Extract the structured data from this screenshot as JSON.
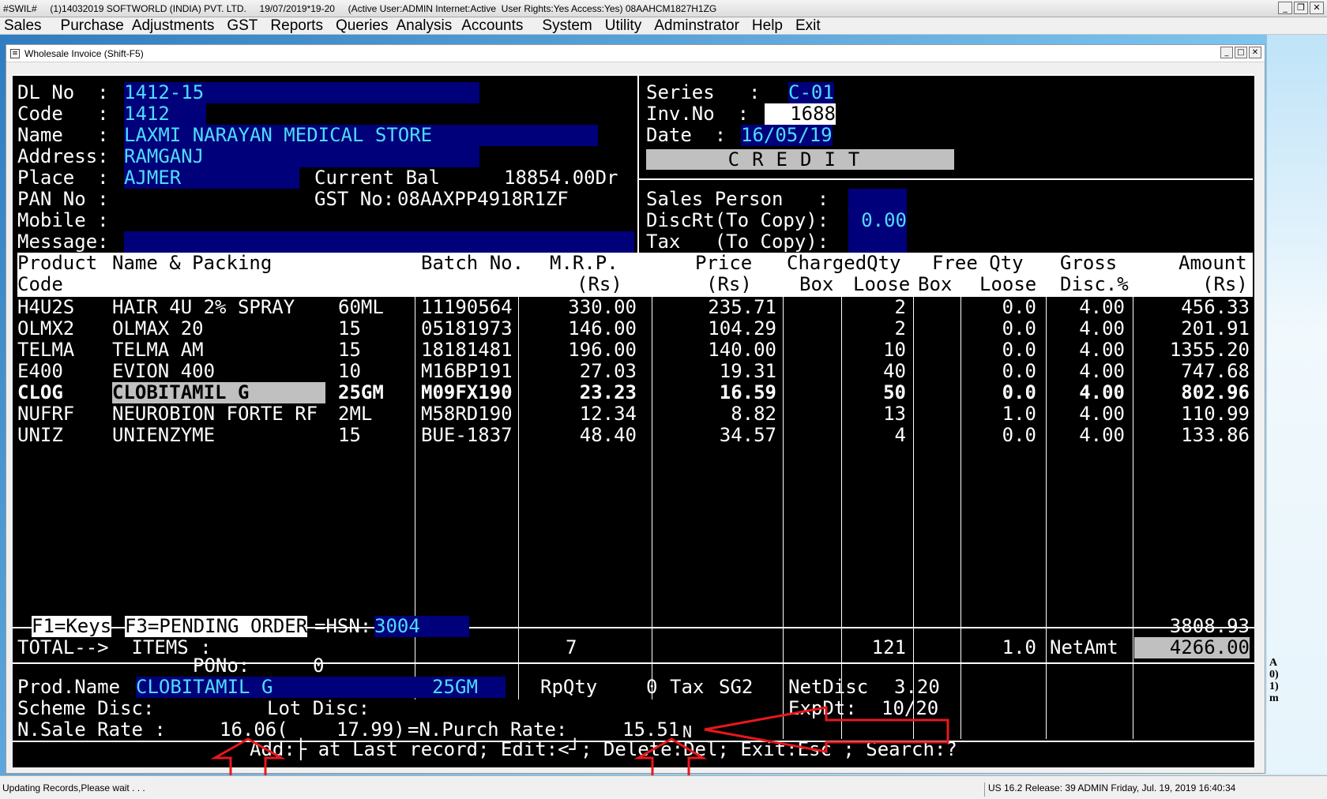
{
  "app_title": "#SWIL#     (1)14032019 SOFTWORLD (INDIA) PVT. LTD.     19/07/2019*19-20     (Active User:ADMIN Internet:Active  User Rights:Yes Access:Yes) 08AAHCM1827H1ZG",
  "menu": [
    "Sales",
    "Purchase",
    "Adjustments",
    "GST",
    "Reports",
    "Queries",
    "Analysis",
    "Accounts",
    "System",
    "Utility",
    "Adminstrator",
    "Help",
    "Exit"
  ],
  "inner_window_title": "Wholesale Invoice (Shift-F5)",
  "party": {
    "dl_no_label": "DL No  :",
    "dl_no": "1412-15",
    "code_label": "Code   :",
    "code": "1412",
    "name_label": "Name   :",
    "name": "LAXMI NARAYAN MEDICAL STORE",
    "address_label": "Address:",
    "address": "RAMGANJ",
    "place_label": "Place  :",
    "place": "AJMER",
    "current_bal_label": "Current Bal",
    "current_bal": "18854.00Dr",
    "pan_label": "PAN No :",
    "gst_label": "GST No:",
    "gst": "08AAXPP4918R1ZF",
    "mobile_label": "Mobile :",
    "message_label": "Message:"
  },
  "invoice": {
    "series_label": "Series   :",
    "series": "C-01",
    "inv_label": "Inv.No  :",
    "inv_no": "1688",
    "date_label": "Date  :",
    "date": "16/05/19",
    "mode": "CREDIT",
    "sales_person_label": "Sales Person   :",
    "discrt_label": "DiscRt(To Copy):",
    "discrt": "0.00",
    "tax_label": "Tax   (To Copy):"
  },
  "columns": {
    "product": "Product",
    "code": "Code",
    "name_packing": "Name & Packing",
    "batch": "Batch No.",
    "mrp": "M.R.P.",
    "mrp_unit": "(Rs)",
    "price": "Price",
    "price_unit": "(Rs)",
    "charged_qty": "ChargedQty",
    "box": "Box",
    "loose": "Loose",
    "free_qty": "Free Qty",
    "free_box": "Box",
    "free_loose": "Loose",
    "gross": "Gross",
    "disc": "Disc.%",
    "amount": "Amount",
    "amount_unit": "(Rs)"
  },
  "rows": [
    {
      "code": "H4U2S",
      "name": "HAIR 4U 2% SPRAY",
      "pack": "60ML",
      "batch": "11190564",
      "mrp": "330.00",
      "price": "235.71",
      "loose": "2",
      "free": "0.0",
      "disc": "4.00",
      "amount": "456.33"
    },
    {
      "code": "OLMX2",
      "name": "OLMAX 20",
      "pack": "15",
      "batch": "05181973",
      "mrp": "146.00",
      "price": "104.29",
      "loose": "2",
      "free": "0.0",
      "disc": "4.00",
      "amount": "201.91"
    },
    {
      "code": "TELMA",
      "name": "TELMA AM",
      "pack": "15",
      "batch": "18181481",
      "mrp": "196.00",
      "price": "140.00",
      "loose": "10",
      "free": "0.0",
      "disc": "4.00",
      "amount": "1355.20"
    },
    {
      "code": "E400",
      "name": "EVION 400",
      "pack": "10",
      "batch": "M16BP191",
      "mrp": "27.03",
      "price": "19.31",
      "loose": "40",
      "free": "0.0",
      "disc": "4.00",
      "amount": "747.68"
    },
    {
      "code": "CLOG",
      "name": "CLOBITAMIL G",
      "pack": "25GM",
      "batch": "M09FX190",
      "mrp": "23.23",
      "price": "16.59",
      "loose": "50",
      "free": "0.0",
      "disc": "4.00",
      "amount": "802.96"
    },
    {
      "code": "NUFRF",
      "name": "NEUROBION FORTE RF",
      "pack": "2ML",
      "batch": "M58RD190",
      "mrp": "12.34",
      "price": "8.82",
      "loose": "13",
      "free": "1.0",
      "disc": "4.00",
      "amount": "110.99"
    },
    {
      "code": "UNIZ",
      "name": "UNIENZYME",
      "pack": "15",
      "batch": "BUE-1837",
      "mrp": "48.40",
      "price": "34.57",
      "loose": "4",
      "free": "0.0",
      "disc": "4.00",
      "amount": "133.86"
    }
  ],
  "footer": {
    "f1": "F1=Keys",
    "f3": "F3=PENDING ORDER",
    "hsn_label": "=HSN:",
    "hsn": "3004",
    "gross_total": "3808.93",
    "total_label": "TOTAL-->  ITEMS :",
    "items": "7",
    "total_qty": "121",
    "total_free": "1.0",
    "netamt_label": "NetAmt",
    "netamt": "4266.00",
    "pono_label": "PONo:",
    "pono": "0"
  },
  "detail": {
    "prod_name_label": "Prod.Name",
    "prod_name": "CLOBITAMIL G",
    "prod_pack": "25GM",
    "rpqty_label": "RpQty",
    "rpqty": "0",
    "tax_label": "Tax",
    "tax": "SG2",
    "netdisc_label": "NetDisc",
    "netdisc": "3.20",
    "scheme_label": "Scheme Disc:",
    "lot_label": "Lot Disc:",
    "expdt_label": "ExpDt:",
    "expdt": "10/20",
    "sale_rate_label": "N.Sale Rate :",
    "sale_rate": "16.06(",
    "sale_rate_2": "17.99)",
    "purch_rate_label": "=N.Purch Rate:",
    "purch_rate": "15.51",
    "purch_suffix": "N",
    "help_line": "Add:├ at Last record; Edit:<┘; Delete:Del; Exit:Esc ; Search:?"
  },
  "status": {
    "left": "Updating Records,Please wait . . .",
    "right": "US 16.2 Release: 39 ADMIN  Friday, Jul. 19, 2019  16:40:34"
  },
  "side_text": "A\n0)\n1)\nm",
  "colors": {
    "highlight_bg": "#00007a",
    "highlight_fg": "#4fdcff",
    "annotation": "#e8181c"
  }
}
